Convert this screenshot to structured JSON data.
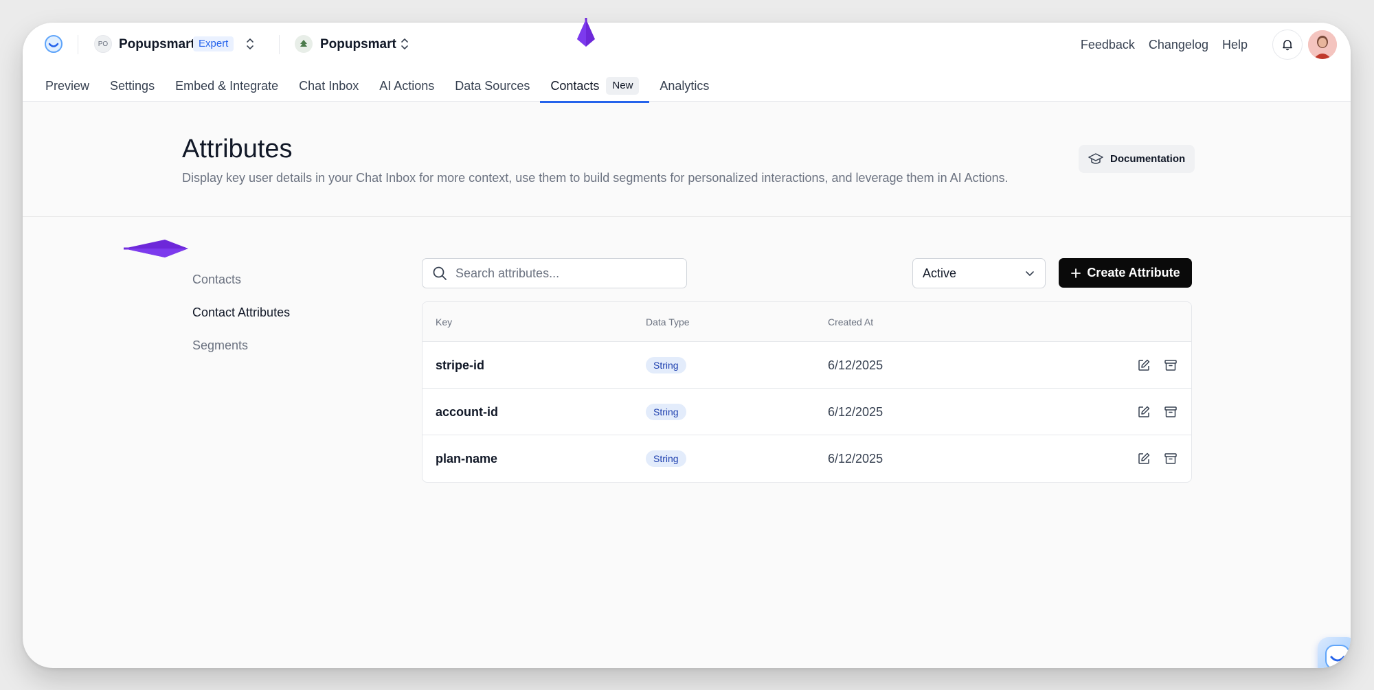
{
  "header": {
    "workspace": {
      "initials": "PO",
      "name": "Popupsmart",
      "badge": "Expert"
    },
    "project": {
      "name": "Popupsmart"
    },
    "links": [
      "Feedback",
      "Changelog",
      "Help"
    ]
  },
  "tabs": [
    {
      "label": "Preview"
    },
    {
      "label": "Settings"
    },
    {
      "label": "Embed & Integrate"
    },
    {
      "label": "Chat Inbox"
    },
    {
      "label": "AI Actions"
    },
    {
      "label": "Data Sources"
    },
    {
      "label": "Contacts",
      "badge": "New",
      "active": true
    },
    {
      "label": "Analytics"
    }
  ],
  "page": {
    "title": "Attributes",
    "description": "Display key user details in your Chat Inbox for more context, use them to build segments for personalized interactions, and leverage them in AI Actions.",
    "doc_button": "Documentation"
  },
  "side_nav": [
    {
      "label": "Contacts"
    },
    {
      "label": "Contact Attributes",
      "active": true
    },
    {
      "label": "Segments"
    }
  ],
  "toolbar": {
    "search_placeholder": "Search attributes...",
    "status_value": "Active",
    "create_label": "Create Attribute"
  },
  "table": {
    "columns": [
      "Key",
      "Data Type",
      "Created At"
    ],
    "rows": [
      {
        "key": "stripe-id",
        "type": "String",
        "created": "6/12/2025"
      },
      {
        "key": "account-id",
        "type": "String",
        "created": "6/12/2025"
      },
      {
        "key": "plan-name",
        "type": "String",
        "created": "6/12/2025"
      }
    ]
  },
  "colors": {
    "accent": "#2563eb",
    "annotation_arrow": "#6d28d9",
    "primary_button": "#0a0a0a"
  },
  "icons": [
    "logo-icon",
    "updown-chevron-icon",
    "tree-icon",
    "bell-icon",
    "graduation-cap-icon",
    "search-icon",
    "chevron-down-icon",
    "plus-icon",
    "edit-icon",
    "archive-icon",
    "chat-bubble-icon"
  ]
}
